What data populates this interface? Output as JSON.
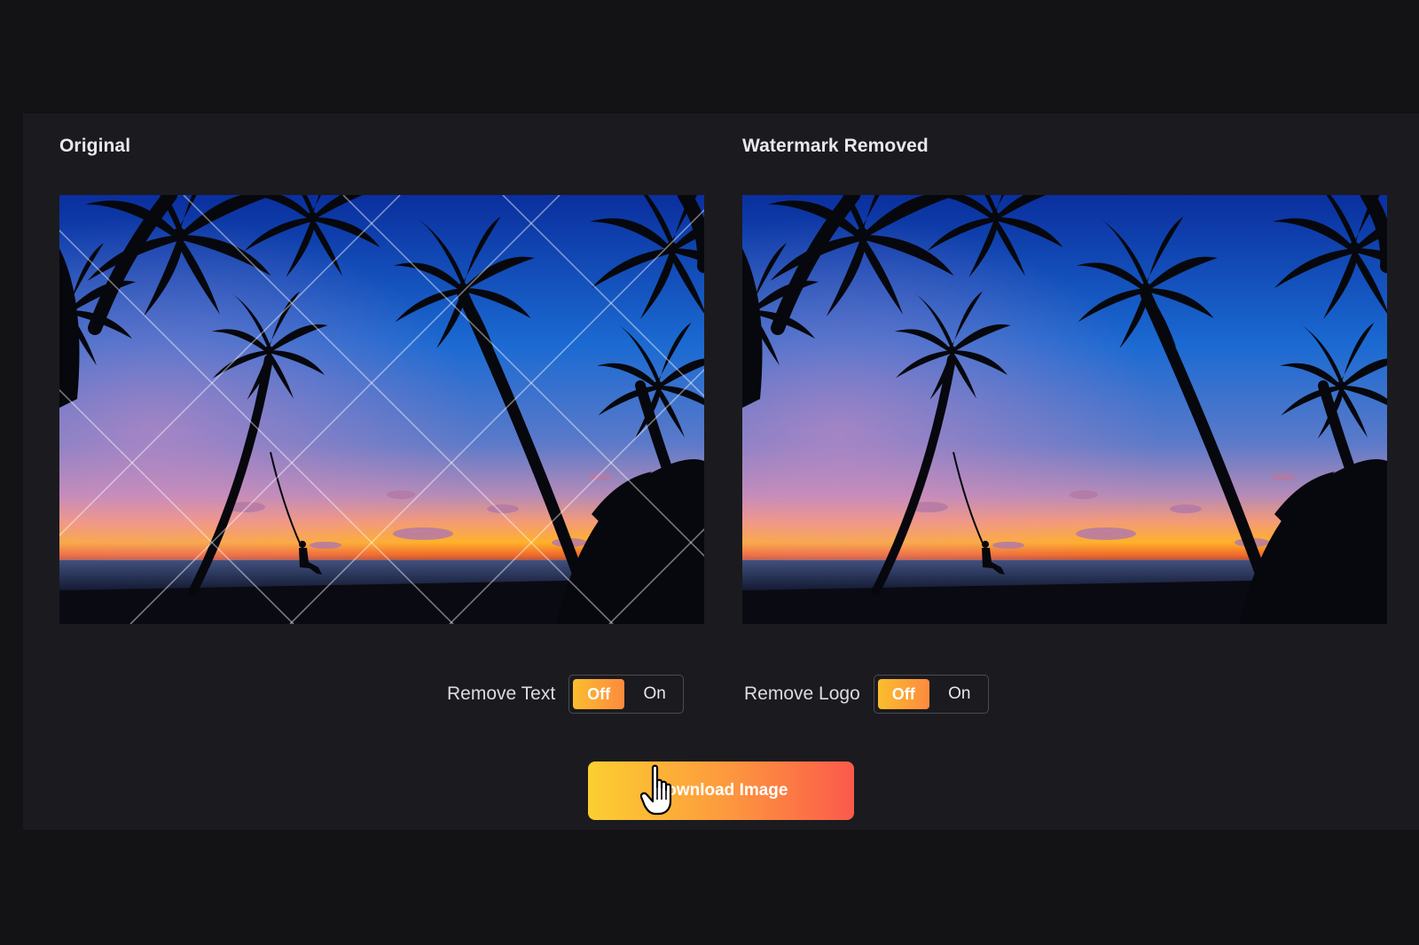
{
  "panels": {
    "original_title": "Original",
    "result_title": "Watermark Removed"
  },
  "controls": {
    "remove_text": {
      "label": "Remove Text",
      "off_label": "Off",
      "on_label": "On",
      "selected": "Off"
    },
    "remove_logo": {
      "label": "Remove Logo",
      "off_label": "Off",
      "on_label": "On",
      "selected": "Off"
    }
  },
  "download": {
    "label": "Download Image"
  },
  "icons": {
    "cursor": "hand-pointer-icon"
  },
  "colors": {
    "page_background": "#131316",
    "panel_background": "#1b1b1f",
    "toggle_active_start": "#fbbd2e",
    "toggle_active_end": "#fd8a3e",
    "button_gradient_start": "#fbcf31",
    "button_gradient_end": "#fb5a4b"
  }
}
